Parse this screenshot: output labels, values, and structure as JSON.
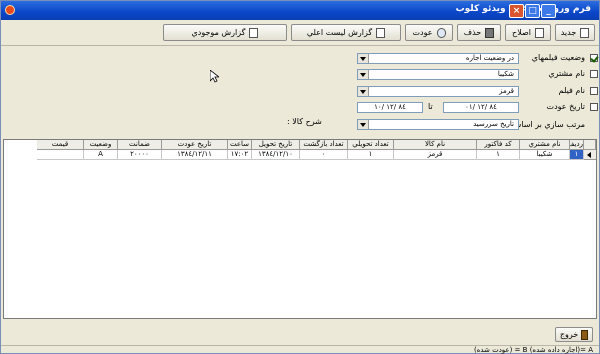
{
  "window": {
    "title": "فرم ورود اطلاعات ويدئو كلوب"
  },
  "toolbar": {
    "new_label": "جديد",
    "edit_label": "اصلاح",
    "delete_label": "حذف",
    "return_label": "عودت",
    "blacklist_report_label": "گزارش ليست اعلي",
    "inventory_report_label": "گزارش موجودي"
  },
  "filters": {
    "film_status": {
      "label": "وضعيت فيلمهاي",
      "checked": true,
      "value": "در وضعيت اجاره"
    },
    "customer_name": {
      "label": "نام مشتري",
      "checked": false,
      "value": "شكيبا"
    },
    "film_name": {
      "label": "نام فيلم",
      "checked": false,
      "value": "قرمز"
    },
    "return_date": {
      "label": "تاريخ عودت",
      "checked": false,
      "from": "٨٤ /١٢ /٠١",
      "to_label": "تا",
      "to": "٨٤ /١٢ /١٠"
    },
    "sort_by": {
      "label": "مرتب سازي بر اساس",
      "value": "تاريخ سررسيد"
    },
    "description": {
      "label": "شرح كالا :"
    }
  },
  "grid": {
    "columns": [
      "رديف",
      "نام مشتري",
      "كد فاكتور",
      "نام كالا",
      "تعداد تحويلي",
      "تعداد بازگشت",
      "تاريخ تحويل",
      "ساعت",
      "تاريخ عودت",
      "ضمانت",
      "وضعيت",
      "قيمت"
    ],
    "rows": [
      [
        "١",
        "شكيبا",
        "١",
        "قرمز",
        "١",
        "٠",
        "١٣٨٤/١٢/١٠",
        "١٧:٠٢",
        "١٣٨٤/١٢/١١",
        "٢٠٠٠٠",
        "A",
        ""
      ]
    ]
  },
  "footer": {
    "exit_label": "خروج",
    "legend": "A =(اجاره داده شده)  B = (عودت شده)"
  }
}
